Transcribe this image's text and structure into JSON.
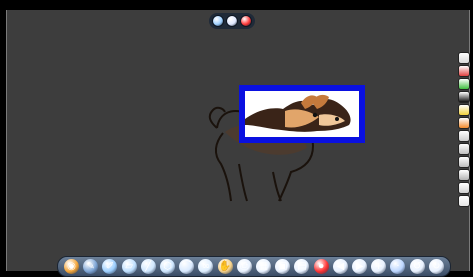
{
  "window": {
    "top_controls": [
      {
        "name": "minimize",
        "color": "#9fd0ff"
      },
      {
        "name": "restore",
        "color": "#dfe8ff"
      },
      {
        "name": "close",
        "color": "#ff3a3a"
      }
    ]
  },
  "canvas": {
    "background": "#3d3d3d",
    "image": "dog-illustration",
    "highlight_box": {
      "border_color": "#0a10e0",
      "fill": "#ffffff"
    }
  },
  "right_toolbar": {
    "tools": [
      {
        "icon": "glass-icon",
        "color": "#d9d9d9"
      },
      {
        "icon": "red-marker-icon",
        "color": "#e04040"
      },
      {
        "icon": "green-marker-icon",
        "color": "#3fbf3f"
      },
      {
        "icon": "black-marker-icon",
        "color": "#111111"
      },
      {
        "icon": "yellow-marker-icon",
        "color": "#f2d23c"
      },
      {
        "icon": "orange-marker-icon",
        "color": "#f28a2c"
      },
      {
        "icon": "pen-icon",
        "color": "#cccccc"
      },
      {
        "icon": "brush-icon",
        "color": "#c0c0c0"
      },
      {
        "icon": "eraser-icon",
        "color": "#bdbdbd"
      },
      {
        "icon": "highlighter-icon",
        "color": "#b3b3b3"
      },
      {
        "icon": "pointer-icon",
        "color": "#d0d0d0"
      },
      {
        "icon": "cup-icon",
        "color": "#e6e6e6"
      }
    ]
  },
  "bottom_toolbar": {
    "tools": [
      {
        "icon": "start-icon",
        "glyph": "◉",
        "color": "#f4a63a"
      },
      {
        "icon": "pen-icon",
        "glyph": "✎",
        "color": "#7fa6d6"
      },
      {
        "icon": "highlighter-icon",
        "glyph": "✐",
        "color": "#9ed0ff"
      },
      {
        "icon": "eraser-icon",
        "glyph": "▱",
        "color": "#bfe0ff"
      },
      {
        "icon": "line-icon",
        "glyph": "╱",
        "color": "#cfe7ff"
      },
      {
        "icon": "shape-icon",
        "glyph": "⬡",
        "color": "#cfe7ff"
      },
      {
        "icon": "capture-icon",
        "glyph": "⌒",
        "color": "#d9eaff"
      },
      {
        "icon": "glasses-icon",
        "glyph": "∞",
        "color": "#dfefff"
      },
      {
        "icon": "hand-icon",
        "glyph": "✋",
        "color": "#f5d18a"
      },
      {
        "icon": "print-icon",
        "glyph": "⎙",
        "color": "#e9f2ff"
      },
      {
        "icon": "table-icon",
        "glyph": "▦",
        "color": "#e9f2ff"
      },
      {
        "icon": "photo-icon",
        "glyph": "▣",
        "color": "#e9f2ff"
      },
      {
        "icon": "folder-icon",
        "glyph": "▤",
        "color": "#e9f2ff"
      },
      {
        "icon": "record-icon",
        "glyph": "⏺",
        "color": "#ff3333"
      },
      {
        "icon": "back-icon",
        "glyph": "◀",
        "color": "#e9f2ff"
      },
      {
        "icon": "forward-icon",
        "glyph": "▶",
        "color": "#e9f2ff"
      },
      {
        "icon": "add-page-icon",
        "glyph": "+",
        "color": "#e9f2ff"
      },
      {
        "icon": "separator-icon",
        "glyph": "·",
        "color": "#bcd6ff"
      },
      {
        "icon": "undo-icon",
        "glyph": "↺",
        "color": "#e9f2ff"
      },
      {
        "icon": "redo-icon",
        "glyph": "↻",
        "color": "#e9f2ff"
      }
    ]
  }
}
